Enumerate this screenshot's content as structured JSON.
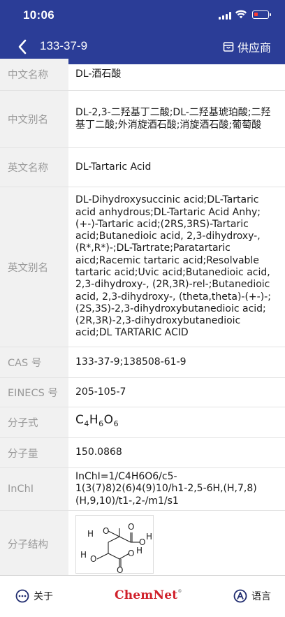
{
  "status": {
    "time": "10:06"
  },
  "nav": {
    "title": "133-37-9",
    "supplier_label": "供应商"
  },
  "rows": [
    {
      "label": "中文名称",
      "value": "DL-酒石酸"
    },
    {
      "label": "中文别名",
      "value": "DL-2,3-二羟基丁二酸;DL-二羟基琥珀酸;二羟基丁二酸;外消旋酒石酸;消旋酒石酸;葡萄酸"
    },
    {
      "label": "英文名称",
      "value": "DL-Tartaric Acid"
    },
    {
      "label": "英文别名",
      "value": "DL-Dihydroxysuccinic acid;DL-Tartaric acid anhydrous;DL-Tartaric Acid Anhy;(+-)-Tartaric acid;(2RS,3RS)-Tartaric acid;Butanedioic acid, 2,3-dihydroxy-, (R*,R*)-;DL-Tartrate;Paratartaric aicd;Racemic tartaric acid;Resolvable tartaric acid;Uvic acid;Butanedioic acid, 2,3-dihydroxy-, (2R,3R)-rel-;Butanedioic acid, 2,3-dihydroxy-, (theta,theta)-(+-)-;(2S,3S)-2,3-dihydroxybutanedioic acid;(2R,3R)-2,3-dihydroxybutanedioic acid;DL TARTARIC ACID"
    },
    {
      "label": "CAS 号",
      "value": "133-37-9;138508-61-9"
    },
    {
      "label": "EINECS 号",
      "value": "205-105-7"
    },
    {
      "label": "分子式",
      "formula": {
        "c": "C",
        "c_n": "4",
        "h": "H",
        "h_n": "6",
        "o": "O",
        "o_n": "6"
      }
    },
    {
      "label": "分子量",
      "value": "150.0868"
    },
    {
      "label": "InChI",
      "value": "InChI=1/C4H6O6/c5-1(3(7)8)2(6)4(9)10/h1-2,5-6H,(H,7,8)(H,9,10)/t1-,2-/m1/s1"
    },
    {
      "label": "分子结构",
      "structure_atoms": [
        "H",
        "O",
        "O",
        "O",
        "H",
        "H",
        "O",
        "O",
        "H",
        "O"
      ]
    }
  ],
  "bottom": {
    "about_label": "关于",
    "logo_text": "ChemNet",
    "logo_mark": "®",
    "language_label": "语言"
  },
  "icons": {
    "back": "chevron-left-icon",
    "supplier": "store-icon",
    "about": "more-circle-icon",
    "language": "language-a-icon"
  },
  "colors": {
    "header": "#2b3d97",
    "logo": "#d0202a",
    "label_bg": "#f1f1f1"
  }
}
